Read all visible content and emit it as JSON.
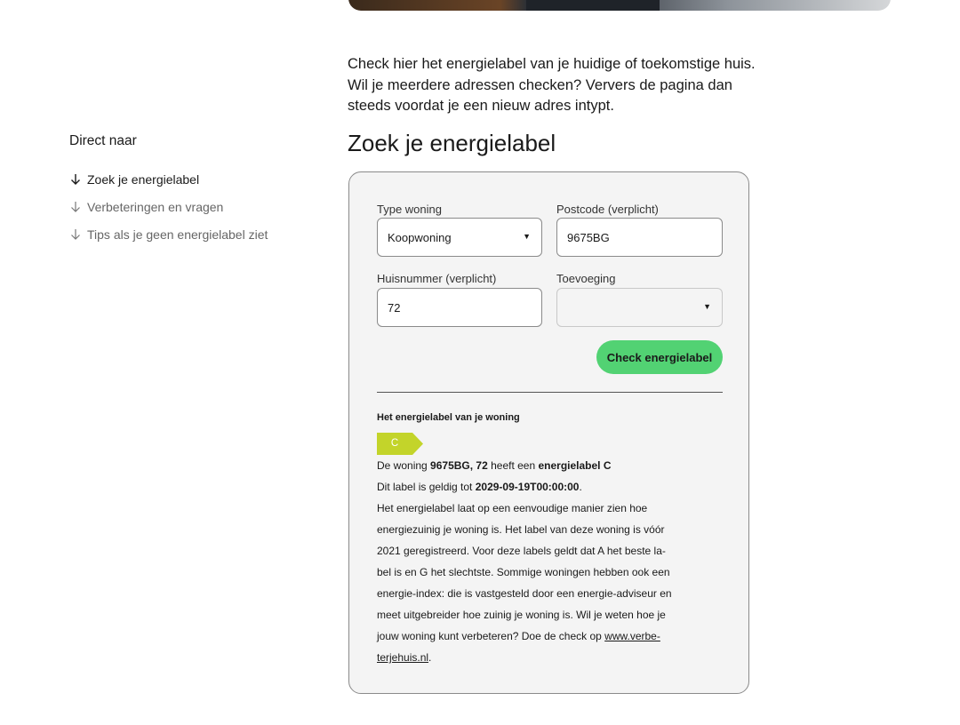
{
  "intro": {
    "lines": [
      "Check hier het energielabel van je huidige of toekomstige huis.",
      "Wil je meerdere adressen checken? Ververs de pagina dan",
      "steeds voordat je een nieuw adres intypt."
    ]
  },
  "sidebar": {
    "title": "Direct naar",
    "items": [
      {
        "label": "Zoek je energielabel",
        "icon": "arrow-down-icon"
      },
      {
        "label": "Verbeteringen en vragen",
        "icon": "arrow-down-icon"
      },
      {
        "label": "Tips als je geen energielabel ziet",
        "icon": "arrow-down-icon"
      }
    ]
  },
  "page_title": "Zoek je energielabel",
  "form": {
    "type_woning": {
      "label": "Type woning",
      "value": "Koopwoning",
      "icon": "caret-down-icon"
    },
    "postcode": {
      "label": "Postcode (verplicht)",
      "value": "9675BG"
    },
    "huisnummer": {
      "label": "Huisnummer (verplicht)",
      "value": "72"
    },
    "toevoeging": {
      "label": "Toevoeging",
      "value": "",
      "icon": "caret-down-icon"
    },
    "submit_label": "Check energielabel"
  },
  "colors": {
    "accent_green": "#52d273",
    "label_c": "#c3d42a",
    "card_bg": "#f4f4f4"
  },
  "result": {
    "heading": "Het energielabel van je woning",
    "label": "C",
    "line1": {
      "prefix": "De woning ",
      "address": "9675BG, 72",
      "middle": " heeft een ",
      "label_text": "energielabel C"
    },
    "line2": {
      "prefix": "Dit label is geldig tot ",
      "date": "2029-09-19T00:00:00",
      "suffix": "."
    },
    "body_lines": [
      "Het energielabel laat op een eenvoudige manier zien hoe",
      "energiezuinig je woning is. Het label van deze woning is vóór",
      "2021 geregistreerd. Voor deze labels geldt dat A het beste la-",
      "bel is en G het slechtste. Sommige woningen hebben ook een",
      "energie-index: die is vastgesteld door een energie-adviseur en",
      "meet uitgebreider hoe zuinig je woning is. Wil je weten hoe je"
    ],
    "last_line_prefix": "jouw woning kunt verbeteren? Doe de check op ",
    "link_part1": "www.verbe-",
    "link_part2": "terjehuis.nl",
    "link_suffix": "."
  }
}
